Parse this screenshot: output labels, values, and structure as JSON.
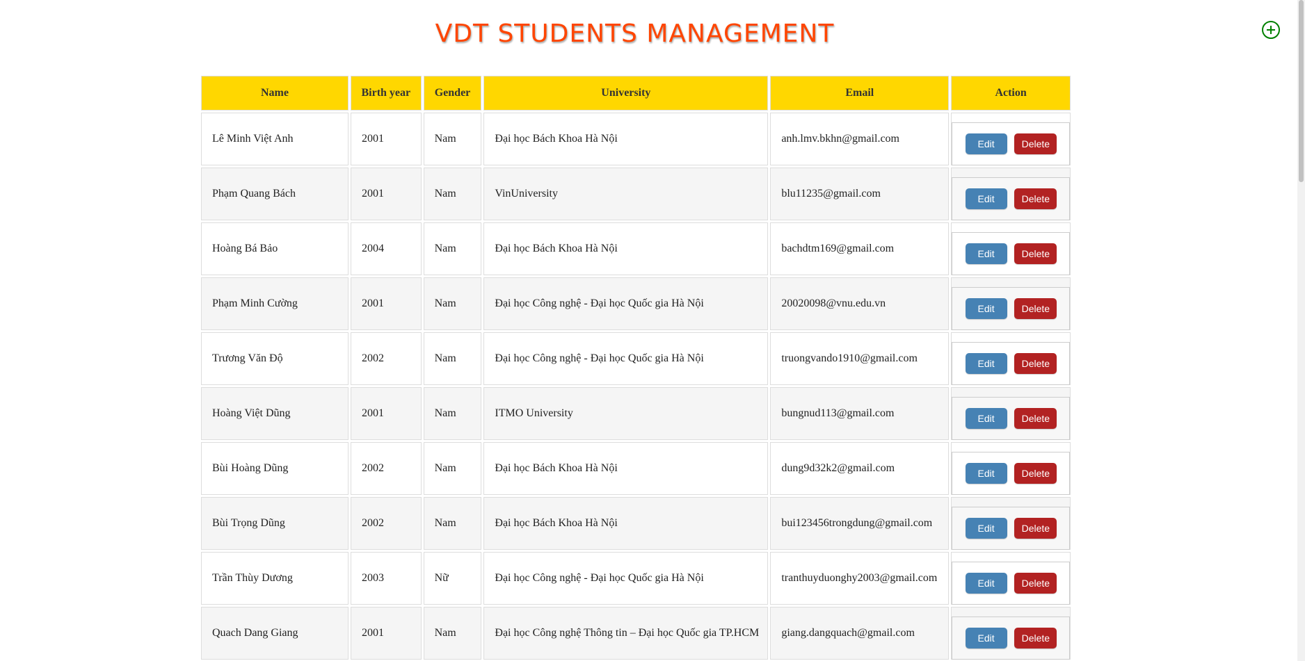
{
  "header": {
    "title": "VDT STUDENTS MANAGEMENT",
    "add_icon": "plus-circle-icon",
    "add_icon_color": "#008000"
  },
  "table": {
    "columns": [
      "Name",
      "Birth year",
      "Gender",
      "University",
      "Email",
      "Action"
    ],
    "header_bg": "#ffd700",
    "rows": [
      {
        "name": "Lê Minh Việt Anh",
        "birth_year": "2001",
        "gender": "Nam",
        "university": "Đại học Bách Khoa Hà Nội",
        "email": "anh.lmv.bkhn@gmail.com"
      },
      {
        "name": "Phạm Quang Bách",
        "birth_year": "2001",
        "gender": "Nam",
        "university": "VinUniversity",
        "email": "blu11235@gmail.com"
      },
      {
        "name": "Hoàng Bá Bảo",
        "birth_year": "2004",
        "gender": "Nam",
        "university": "Đại học Bách Khoa Hà Nội",
        "email": "bachdtm169@gmail.com"
      },
      {
        "name": "Phạm Minh Cường",
        "birth_year": "2001",
        "gender": "Nam",
        "university": "Đại học Công nghệ - Đại học Quốc gia Hà Nội",
        "email": "20020098@vnu.edu.vn"
      },
      {
        "name": "Trương Văn Độ",
        "birth_year": "2002",
        "gender": "Nam",
        "university": "Đại học Công nghệ - Đại học Quốc gia Hà Nội",
        "email": "truongvando1910@gmail.com"
      },
      {
        "name": "Hoàng Việt Dũng",
        "birth_year": "2001",
        "gender": "Nam",
        "university": "ITMO University",
        "email": "bungnud113@gmail.com"
      },
      {
        "name": "Bùi Hoàng Dũng",
        "birth_year": "2002",
        "gender": "Nam",
        "university": "Đại học Bách Khoa Hà Nội",
        "email": "dung9d32k2@gmail.com"
      },
      {
        "name": "Bùi Trọng Dũng",
        "birth_year": "2002",
        "gender": "Nam",
        "university": "Đại học Bách Khoa Hà Nội",
        "email": "bui123456trongdung@gmail.com"
      },
      {
        "name": "Trần Thùy Dương",
        "birth_year": "2003",
        "gender": "Nữ",
        "university": "Đại học Công nghệ - Đại học Quốc gia Hà Nội",
        "email": "tranthuyduonghy2003@gmail.com"
      },
      {
        "name": "Quach Dang Giang",
        "birth_year": "2001",
        "gender": "Nam",
        "university": "Đại học Công nghệ Thông tin – Đại học Quốc gia TP.HCM",
        "email": "giang.dangquach@gmail.com"
      }
    ]
  },
  "actions": {
    "edit_label": "Edit",
    "delete_label": "Delete",
    "edit_color": "#4682b4",
    "delete_color": "#b22222"
  }
}
